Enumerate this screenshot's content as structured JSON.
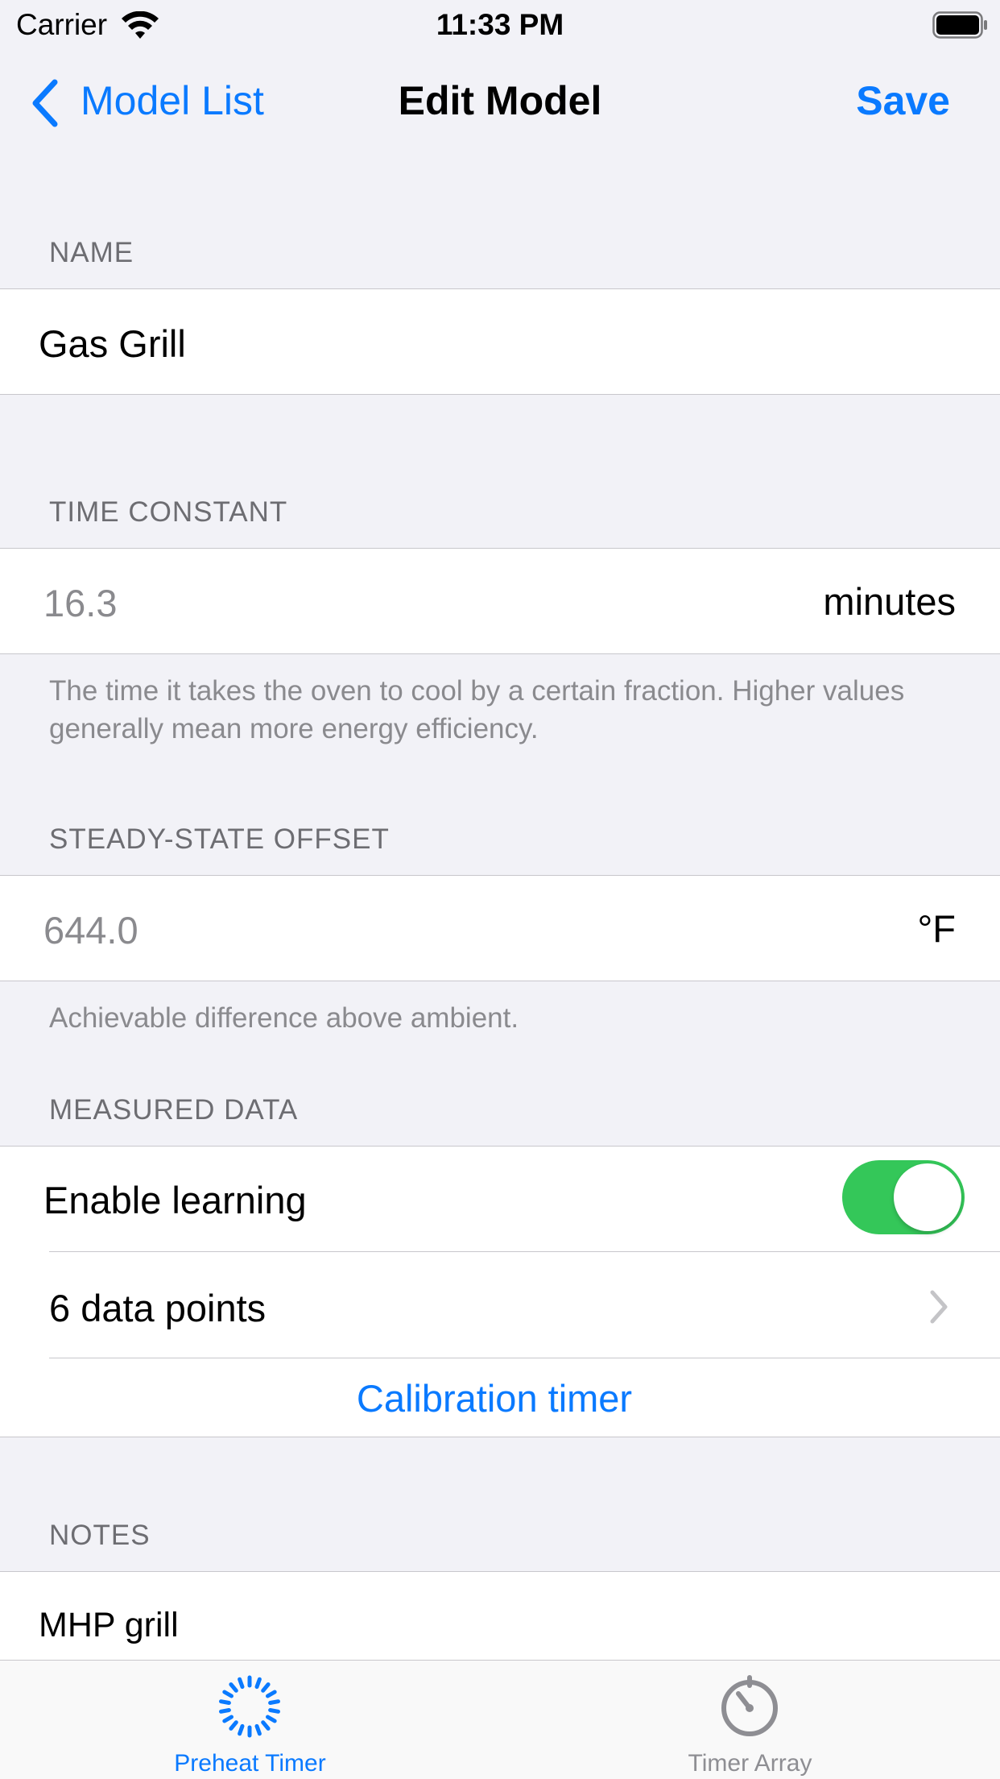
{
  "status_bar": {
    "carrier": "Carrier",
    "time": "11:33 PM"
  },
  "nav": {
    "back_label": "Model List",
    "title": "Edit Model",
    "save_label": "Save"
  },
  "sections": {
    "name": {
      "header": "NAME",
      "value": "Gas Grill"
    },
    "time_constant": {
      "header": "TIME CONSTANT",
      "placeholder": "16.3",
      "unit": "minutes",
      "footer": "The time it takes the oven to cool by a certain fraction. Higher values generally mean more energy efficiency."
    },
    "steady_state": {
      "header": "STEADY-STATE OFFSET",
      "placeholder": "644.0",
      "unit": "°F",
      "footer": "Achievable difference above ambient."
    },
    "measured": {
      "header": "MEASURED DATA",
      "enable_learning_label": "Enable learning",
      "enable_learning_on": true,
      "data_points_label": "6 data points",
      "calibration_label": "Calibration timer"
    },
    "notes": {
      "header": "NOTES",
      "value": "MHP grill"
    }
  },
  "tabs": [
    {
      "label": "Preheat Timer",
      "icon": "preheat-timer-icon",
      "selected": true
    },
    {
      "label": "Timer Array",
      "icon": "stopwatch-icon",
      "selected": false
    }
  ],
  "colors": {
    "accent": "#0a7aff",
    "toggle_on": "#34c759",
    "background": "#f2f2f7",
    "tab_inactive": "#8e8e93"
  }
}
